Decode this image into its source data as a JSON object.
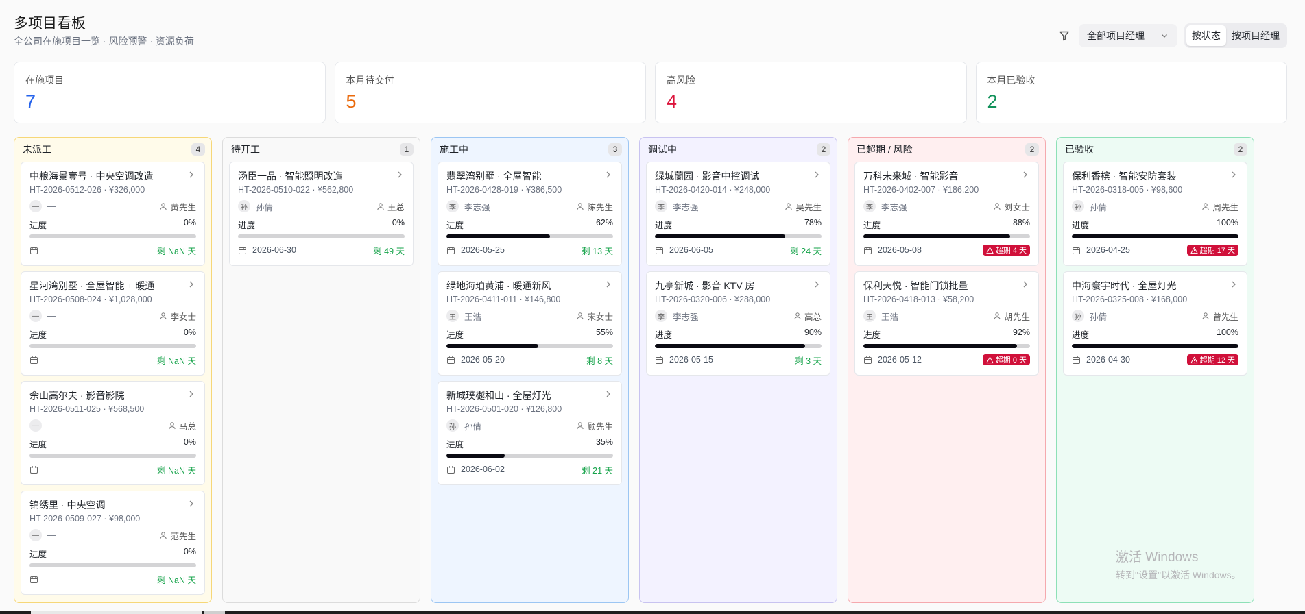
{
  "header": {
    "title": "多项目看板",
    "subtitle": "全公司在施项目一览 · 风险预警 · 资源负荷",
    "manager_filter": "全部项目经理",
    "view_modes": [
      "按状态",
      "按项目经理"
    ],
    "active_view": "按状态"
  },
  "stats": [
    {
      "label": "在施项目",
      "value": "7",
      "color": "#2563eb"
    },
    {
      "label": "本月待交付",
      "value": "5",
      "color": "#ea6a0c"
    },
    {
      "label": "高风险",
      "value": "4",
      "color": "#dc143c"
    },
    {
      "label": "本月已验收",
      "value": "2",
      "color": "#11915a"
    }
  ],
  "progress_label": "进度",
  "columns": [
    {
      "title": "未派工",
      "count": "4",
      "bg": "#fffbea",
      "border": "#f6d778",
      "cards": [
        {
          "name": "中粮海景壹号 · 中央空调改造",
          "meta": "HT-2026-0512-026 · ¥326,000",
          "avatar": "—",
          "pm": "—",
          "client": "黄先生",
          "progress_text": "0%",
          "progress": 0,
          "due": "",
          "tag_kind": "remain",
          "tag": "剩 NaN 天"
        },
        {
          "name": "星河湾别墅 · 全屋智能 + 暖通",
          "meta": "HT-2026-0508-024 · ¥1,028,000",
          "avatar": "—",
          "pm": "—",
          "client": "李女士",
          "progress_text": "0%",
          "progress": 0,
          "due": "",
          "tag_kind": "remain",
          "tag": "剩 NaN 天"
        },
        {
          "name": "佘山高尔夫 · 影音影院",
          "meta": "HT-2026-0511-025 · ¥568,500",
          "avatar": "—",
          "pm": "—",
          "client": "马总",
          "progress_text": "0%",
          "progress": 0,
          "due": "",
          "tag_kind": "remain",
          "tag": "剩 NaN 天"
        },
        {
          "name": "锦绣里 · 中央空调",
          "meta": "HT-2026-0509-027 · ¥98,000",
          "avatar": "—",
          "pm": "—",
          "client": "范先生",
          "progress_text": "0%",
          "progress": 0,
          "due": "",
          "tag_kind": "remain",
          "tag": "剩 NaN 天"
        }
      ]
    },
    {
      "title": "待开工",
      "count": "1",
      "bg": "#f9f9f9",
      "border": "#dcdcdc",
      "cards": [
        {
          "name": "汤臣一品 · 智能照明改造",
          "meta": "HT-2026-0510-022 · ¥562,800",
          "avatar": "孙",
          "pm": "孙倩",
          "client": "王总",
          "progress_text": "0%",
          "progress": 0,
          "due": "2026-06-30",
          "tag_kind": "remain",
          "tag": "剩 49 天"
        }
      ]
    },
    {
      "title": "施工中",
      "count": "3",
      "bg": "#eef5ff",
      "border": "#9cc6f3",
      "cards": [
        {
          "name": "翡翠湾别墅 · 全屋智能",
          "meta": "HT-2026-0428-019 · ¥386,500",
          "avatar": "李",
          "pm": "李志强",
          "client": "陈先生",
          "progress_text": "62%",
          "progress": 62,
          "due": "2026-05-25",
          "tag_kind": "remain",
          "tag": "剩 13 天"
        },
        {
          "name": "绿地海珀黄浦 · 暖通新风",
          "meta": "HT-2026-0411-011 · ¥146,800",
          "avatar": "王",
          "pm": "王浩",
          "client": "宋女士",
          "progress_text": "55%",
          "progress": 55,
          "due": "2026-05-20",
          "tag_kind": "remain",
          "tag": "剩 8 天"
        },
        {
          "name": "新城璞樾和山 · 全屋灯光",
          "meta": "HT-2026-0501-020 · ¥126,800",
          "avatar": "孙",
          "pm": "孙倩",
          "client": "顾先生",
          "progress_text": "35%",
          "progress": 35,
          "due": "2026-06-02",
          "tag_kind": "remain",
          "tag": "剩 21 天"
        }
      ]
    },
    {
      "title": "调试中",
      "count": "2",
      "bg": "#f3f2ff",
      "border": "#c8c3f0",
      "cards": [
        {
          "name": "绿城蘭园 · 影音中控调试",
          "meta": "HT-2026-0420-014 · ¥248,000",
          "avatar": "李",
          "pm": "李志强",
          "client": "吴先生",
          "progress_text": "78%",
          "progress": 78,
          "due": "2026-06-05",
          "tag_kind": "remain",
          "tag": "剩 24 天"
        },
        {
          "name": "九亭新城 · 影音 KTV 房",
          "meta": "HT-2026-0320-006 · ¥288,000",
          "avatar": "李",
          "pm": "李志强",
          "client": "高总",
          "progress_text": "90%",
          "progress": 90,
          "due": "2026-05-15",
          "tag_kind": "remain",
          "tag": "剩 3 天"
        }
      ]
    },
    {
      "title": "已超期 / 风险",
      "count": "2",
      "bg": "#ffeff0",
      "border": "#f5a9ae",
      "cards": [
        {
          "name": "万科未来城 · 智能影音",
          "meta": "HT-2026-0402-007 · ¥186,200",
          "avatar": "李",
          "pm": "李志强",
          "client": "刘女士",
          "progress_text": "88%",
          "progress": 88,
          "due": "2026-05-08",
          "tag_kind": "overdue",
          "tag": "超期 4 天"
        },
        {
          "name": "保利天悦 · 智能门锁批量",
          "meta": "HT-2026-0418-013 · ¥58,200",
          "avatar": "王",
          "pm": "王浩",
          "client": "胡先生",
          "progress_text": "92%",
          "progress": 92,
          "due": "2026-05-12",
          "tag_kind": "overdue",
          "tag": "超期 0 天"
        }
      ]
    },
    {
      "title": "已验收",
      "count": "2",
      "bg": "#edfbf4",
      "border": "#8ee0b7",
      "cards": [
        {
          "name": "保利香槟 · 智能安防套装",
          "meta": "HT-2026-0318-005 · ¥98,600",
          "avatar": "孙",
          "pm": "孙倩",
          "client": "周先生",
          "progress_text": "100%",
          "progress": 100,
          "due": "2026-04-25",
          "tag_kind": "overdue",
          "tag": "超期 17 天"
        },
        {
          "name": "中海寰宇时代 · 全屋灯光",
          "meta": "HT-2026-0325-008 · ¥168,000",
          "avatar": "孙",
          "pm": "孙倩",
          "client": "曾先生",
          "progress_text": "100%",
          "progress": 100,
          "due": "2026-04-30",
          "tag_kind": "overdue",
          "tag": "超期 12 天"
        }
      ]
    }
  ],
  "watermark": {
    "line1": "激活 Windows",
    "line2": "转到\"设置\"以激活 Windows。"
  }
}
